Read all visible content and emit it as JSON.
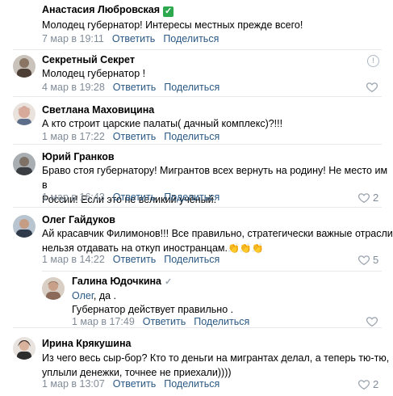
{
  "comments": [
    {
      "name": "Анастасия Любровская",
      "text": "Молодец губернатор! Интересы местных прежде всего!",
      "date": "7 мар в 19:11",
      "reply": "Ответить",
      "share": "Поделиться"
    },
    {
      "name": "Секретный Секрет",
      "text": "Молодец губернатор !",
      "date": "4 мар в 19:28",
      "reply": "Ответить",
      "share": "Поделиться"
    },
    {
      "name": "Светлана Маховицина",
      "text": "А кто строит царские палаты( дачный комплекс)?!!!",
      "date": "1 мар в 17:22",
      "reply": "Ответить",
      "share": "Поделиться"
    },
    {
      "name": "Юрий Гранков",
      "text": "Браво стоя губернатору! Мигрантов всех вернуть на родину! Не место им в\nРоссии! Если это не великий учёный.",
      "date": "1 мар в 16:43",
      "reply": "Ответить",
      "share": "Поделиться",
      "likes": "2"
    },
    {
      "name": "Олег Гайдуков",
      "text": "Ай красавчик Филимонов!!! Все правильно, стратегически важные отрасли\nнельзя отдавать на откуп иностранцам.",
      "emojis": "👏👏👏",
      "date": "1 мар в 14:22",
      "reply": "Ответить",
      "share": "Поделиться",
      "likes": "5"
    },
    {
      "name": "Галина Юдочкина",
      "mention": "Олег",
      "text_after_mention": ", да .",
      "text": "Губернатор действует правильно .",
      "date": "1 мар в 17:49",
      "reply": "Ответить",
      "share": "Поделиться"
    },
    {
      "name": "Ирина Крякушина",
      "text": "Из чего весь сыр-бор? Кто то деньги на мигрантах делал, а теперь тю-тю,\nуплыли денежки, точнее не приехали))))",
      "date": "1 мар в 13:07",
      "reply": "Ответить",
      "share": "Поделиться",
      "likes": "2"
    }
  ],
  "icons": {
    "verified": "✓",
    "more": "!",
    "like": "heart-icon"
  },
  "colors": {
    "link": "#2a5885",
    "meta": "#818c99",
    "separator": "#e7e8ec",
    "verified_badge": "#2ea84e"
  }
}
